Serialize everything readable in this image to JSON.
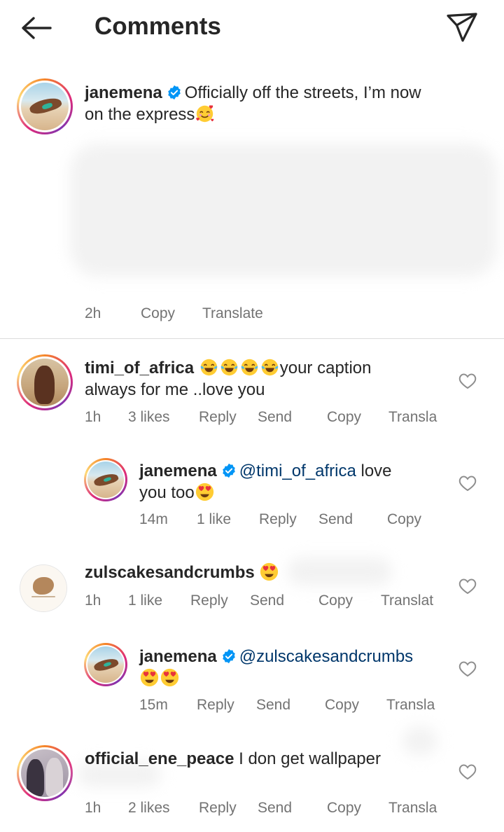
{
  "header": {
    "title": "Comments",
    "back_icon": "arrow-left-icon",
    "share_icon": "paper-plane-icon"
  },
  "caption": {
    "username": "janemena",
    "text_line1": "Officially off the streets, I’m now",
    "text_line2": "on the express",
    "emoji": "smiling-face-with-hearts",
    "time": "2h",
    "copy_label": "Copy",
    "translate_label": "Translate"
  },
  "comments": [
    {
      "username": "timi_of_africa",
      "text_line1": "your caption",
      "text_line2": "always for me ..love you",
      "emojis": "face-with-tears-of-joy x4",
      "time": "1h",
      "likes": "3 likes",
      "reply_label": "Reply",
      "send_label": "Send",
      "copy_label": "Copy",
      "translate_label": "Transla"
    },
    {
      "username": "janemena",
      "mention": "@timi_of_africa",
      "text_after_mention": " love",
      "text_line2": "you too",
      "emoji": "heart-eyes",
      "time": "14m",
      "likes": "1 like",
      "reply_label": "Reply",
      "send_label": "Send",
      "copy_label": "Copy"
    },
    {
      "username": "zulscakesandcrumbs",
      "emoji": "heart-eyes",
      "time": "1h",
      "likes": "1 like",
      "reply_label": "Reply",
      "send_label": "Send",
      "copy_label": "Copy",
      "translate_label": "Translat"
    },
    {
      "username": "janemena",
      "mention": "@zulscakesandcrumbs",
      "emojis": "heart-eyes x2",
      "time": "15m",
      "reply_label": "Reply",
      "send_label": "Send",
      "copy_label": "Copy",
      "translate_label": "Transla"
    },
    {
      "username": "official_ene_peace",
      "text": "I don get wallpaper",
      "time": "1h",
      "likes": "2 likes",
      "reply_label": "Reply",
      "send_label": "Send",
      "copy_label": "Copy",
      "translate_label": "Transla"
    }
  ],
  "colors": {
    "text": "#262626",
    "meta": "#737373",
    "mention": "#00376b",
    "verified": "#0095f6"
  }
}
